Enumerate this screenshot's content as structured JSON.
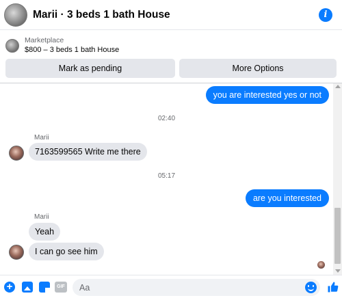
{
  "header": {
    "title": "Marii · 3 beds 1 bath House",
    "info_icon_glyph": "i"
  },
  "marketplace": {
    "label": "Marketplace",
    "listing": "$800 – 3 beds 1 bath House",
    "pending_button": "Mark as pending",
    "more_button": "More Options"
  },
  "messages": [
    {
      "from": "me",
      "text": "you are interested yes or not"
    },
    {
      "type": "time",
      "text": "02:40"
    },
    {
      "from": "Marii",
      "sender": "Marii",
      "text": "7163599565 Write me there"
    },
    {
      "type": "time",
      "text": "05:17"
    },
    {
      "from": "me",
      "text": "are you interested"
    },
    {
      "from": "Marii",
      "sender": "Marii",
      "texts": [
        "Yeah",
        "I can go see him"
      ]
    }
  ],
  "composer": {
    "placeholder": "Aa",
    "gif_label": "GIF",
    "plus_glyph": "+"
  },
  "icons": [
    "info-icon",
    "plus-icon",
    "photo-icon",
    "sticker-icon",
    "gif-icon",
    "emoji-icon",
    "like-icon"
  ],
  "colors": {
    "accent": "#0a7cff",
    "incoming_bubble": "#e4e6eb",
    "button_bg": "#e4e6eb",
    "muted_text": "#65676b"
  }
}
